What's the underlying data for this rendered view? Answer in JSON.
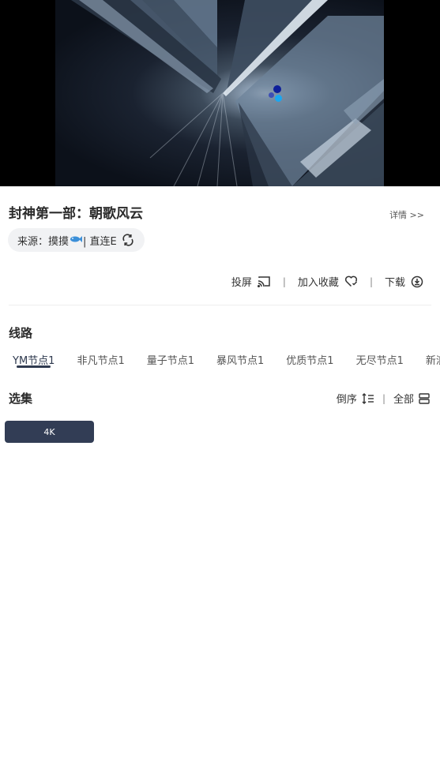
{
  "video": {
    "loading_indicator": "loading-dots"
  },
  "header": {
    "title": "封神第一部：朝歌风云",
    "detail_label": "详情 >>"
  },
  "source": {
    "prefix": "来源：摸摸",
    "suffix": "| 直连E",
    "icons": [
      "fish-icon",
      "refresh-icon"
    ]
  },
  "actions": {
    "cast_label": "投屏",
    "favorite_label": "加入收藏",
    "download_label": "下载"
  },
  "lines": {
    "title": "线路",
    "tabs": [
      {
        "label": "YM节点1",
        "active": true
      },
      {
        "label": "非凡节点1"
      },
      {
        "label": "量子节点1"
      },
      {
        "label": "暴风节点1"
      },
      {
        "label": "优质节点1"
      },
      {
        "label": "无尽节点1"
      },
      {
        "label": "新浪"
      }
    ]
  },
  "episodes": {
    "title": "选集",
    "sort_label": "倒序",
    "all_label": "全部",
    "items": [
      {
        "label": "4K",
        "selected": true
      }
    ]
  },
  "colors": {
    "accent": "#323d55",
    "pill_bg": "#f1f2f4"
  }
}
